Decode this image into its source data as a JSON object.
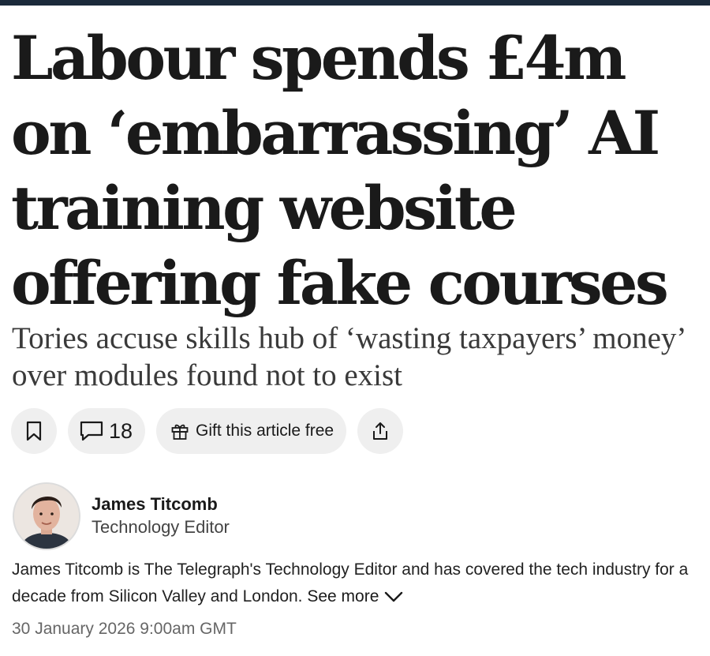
{
  "article": {
    "headline": "Labour spends £4m on ‘embarrassing’ AI training website offering fake courses",
    "standfirst": "Tories accuse skills hub of ‘wasting taxpayers’ money’ over modules found not to exist"
  },
  "actions": {
    "bookmark_icon": "bookmark-icon",
    "comment_icon": "comment-icon",
    "comment_count": "18",
    "gift_icon": "gift-icon",
    "gift_label": "Gift this article free",
    "share_icon": "share-icon"
  },
  "author": {
    "name": "James Titcomb",
    "role": "Technology Editor",
    "bio": "James Titcomb is The Telegraph's Technology Editor and has covered the tech industry for a decade from Silicon Valley and London.",
    "see_more": "See more"
  },
  "published": "30 January 2026 9:00am GMT",
  "colors": {
    "top_bar": "#1b2a3a",
    "pill_background": "#efefef",
    "text": "#1a1a1a",
    "date_text": "#666666"
  }
}
